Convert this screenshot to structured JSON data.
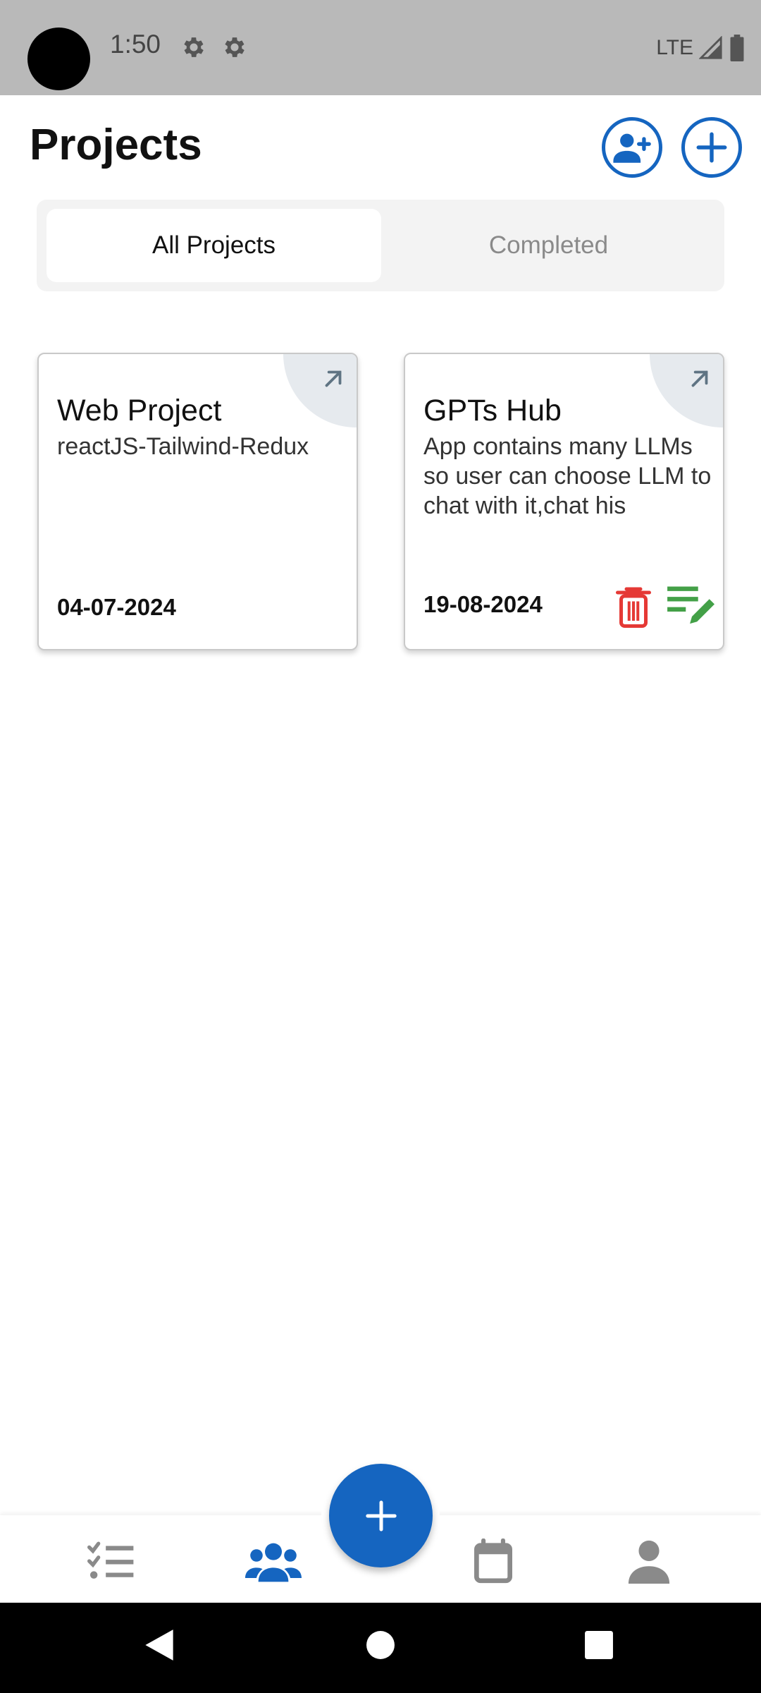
{
  "status_bar": {
    "time": "1:50",
    "network": "LTE",
    "icons": [
      "settings-icon",
      "settings-icon",
      "signal-icon",
      "battery-icon"
    ]
  },
  "header": {
    "title": "Projects",
    "actions": [
      "add-member-icon",
      "add-circle-icon"
    ]
  },
  "tabs": [
    {
      "label": "All Projects",
      "active": true
    },
    {
      "label": "Completed",
      "active": false
    }
  ],
  "projects": [
    {
      "title": "Web Project",
      "description": "reactJS-Tailwind-Redux",
      "date": "04-07-2024",
      "actions": []
    },
    {
      "title": "GPTs Hub",
      "description": "App contains many LLMs so user can choose LLM to chat with it,chat his",
      "date": "19-08-2024",
      "actions": [
        "delete-icon",
        "edit-list-icon"
      ]
    }
  ],
  "bottom_nav": {
    "items": [
      "tasks-icon",
      "team-icon",
      "add-icon",
      "calendar-icon",
      "profile-icon"
    ],
    "active": "team-icon"
  },
  "colors": {
    "primary": "#1565c0",
    "delete": "#e53935",
    "edit": "#43a047",
    "inactive": "#8a8a8a"
  }
}
